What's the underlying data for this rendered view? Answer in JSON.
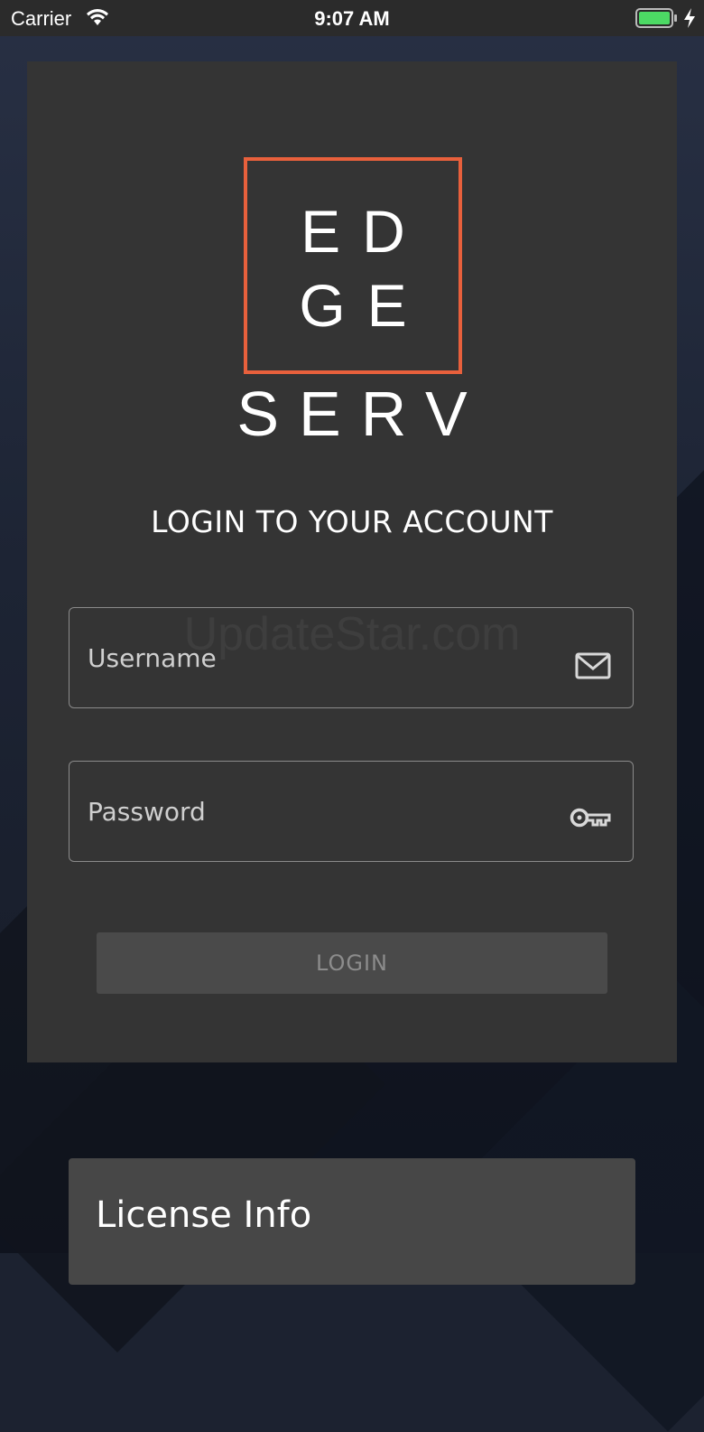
{
  "status_bar": {
    "carrier": "Carrier",
    "time": "9:07 AM"
  },
  "logo": {
    "row1": "ED",
    "row2": "GE",
    "sub": "SERV",
    "accent_color": "#e8603c"
  },
  "login": {
    "heading": "LOGIN TO YOUR ACCOUNT",
    "username_placeholder": "Username",
    "password_placeholder": "Password",
    "button_label": "LOGIN",
    "username_icon": "mail-icon",
    "password_icon": "key-icon"
  },
  "watermark": "UpdateStar.com",
  "license": {
    "title": "License Info"
  }
}
